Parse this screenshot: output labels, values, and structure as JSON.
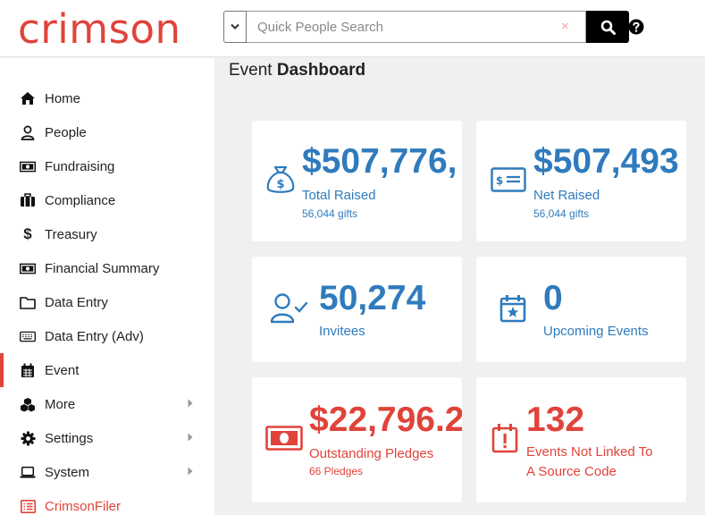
{
  "brand": {
    "name": "crimson",
    "accent": "#e0433a",
    "blue": "#2f7bbd"
  },
  "search": {
    "placeholder": "Quick People Search",
    "clear_label": "×"
  },
  "sidebar": {
    "items": [
      {
        "label": "Home",
        "icon": "home-icon"
      },
      {
        "label": "People",
        "icon": "person-icon"
      },
      {
        "label": "Fundraising",
        "icon": "money-icon"
      },
      {
        "label": "Compliance",
        "icon": "briefcase-icon"
      },
      {
        "label": "Treasury",
        "icon": "dollar-icon"
      },
      {
        "label": "Financial Summary",
        "icon": "money-icon"
      },
      {
        "label": "Data Entry",
        "icon": "folder-icon"
      },
      {
        "label": "Data Entry (Adv)",
        "icon": "keyboard-icon"
      },
      {
        "label": "Event",
        "icon": "calendar-icon",
        "active": true
      },
      {
        "label": "More",
        "icon": "cubes-icon",
        "has_submenu": true
      },
      {
        "label": "Settings",
        "icon": "gear-icon",
        "has_submenu": true
      },
      {
        "label": "System",
        "icon": "laptop-icon",
        "has_submenu": true
      },
      {
        "label": "CrimsonFiler",
        "icon": "list-icon"
      }
    ]
  },
  "main": {
    "title_prefix": "Event",
    "title_bold": "Dashboard",
    "cards": [
      {
        "value": "$507,776,",
        "label": "Total Raised",
        "sub": "56,044 gifts",
        "icon": "money-bag-icon"
      },
      {
        "value": "$507,493",
        "label": "Net Raised",
        "sub": "56,044 gifts",
        "icon": "check-icon"
      },
      {
        "value": "50,274",
        "label": "Invitees",
        "sub": "",
        "icon": "user-check-icon"
      },
      {
        "value": "0",
        "label": "Upcoming Events",
        "sub": "",
        "icon": "calendar-star-icon"
      },
      {
        "value": "$22,796.2",
        "label": "Outstanding Pledges",
        "sub": "66 Pledges",
        "icon": "money-bill-icon"
      },
      {
        "value": "132",
        "label": "Events Not Linked To",
        "label2": "A Source Code",
        "sub": "",
        "icon": "calendar-exclamation-icon"
      }
    ]
  }
}
